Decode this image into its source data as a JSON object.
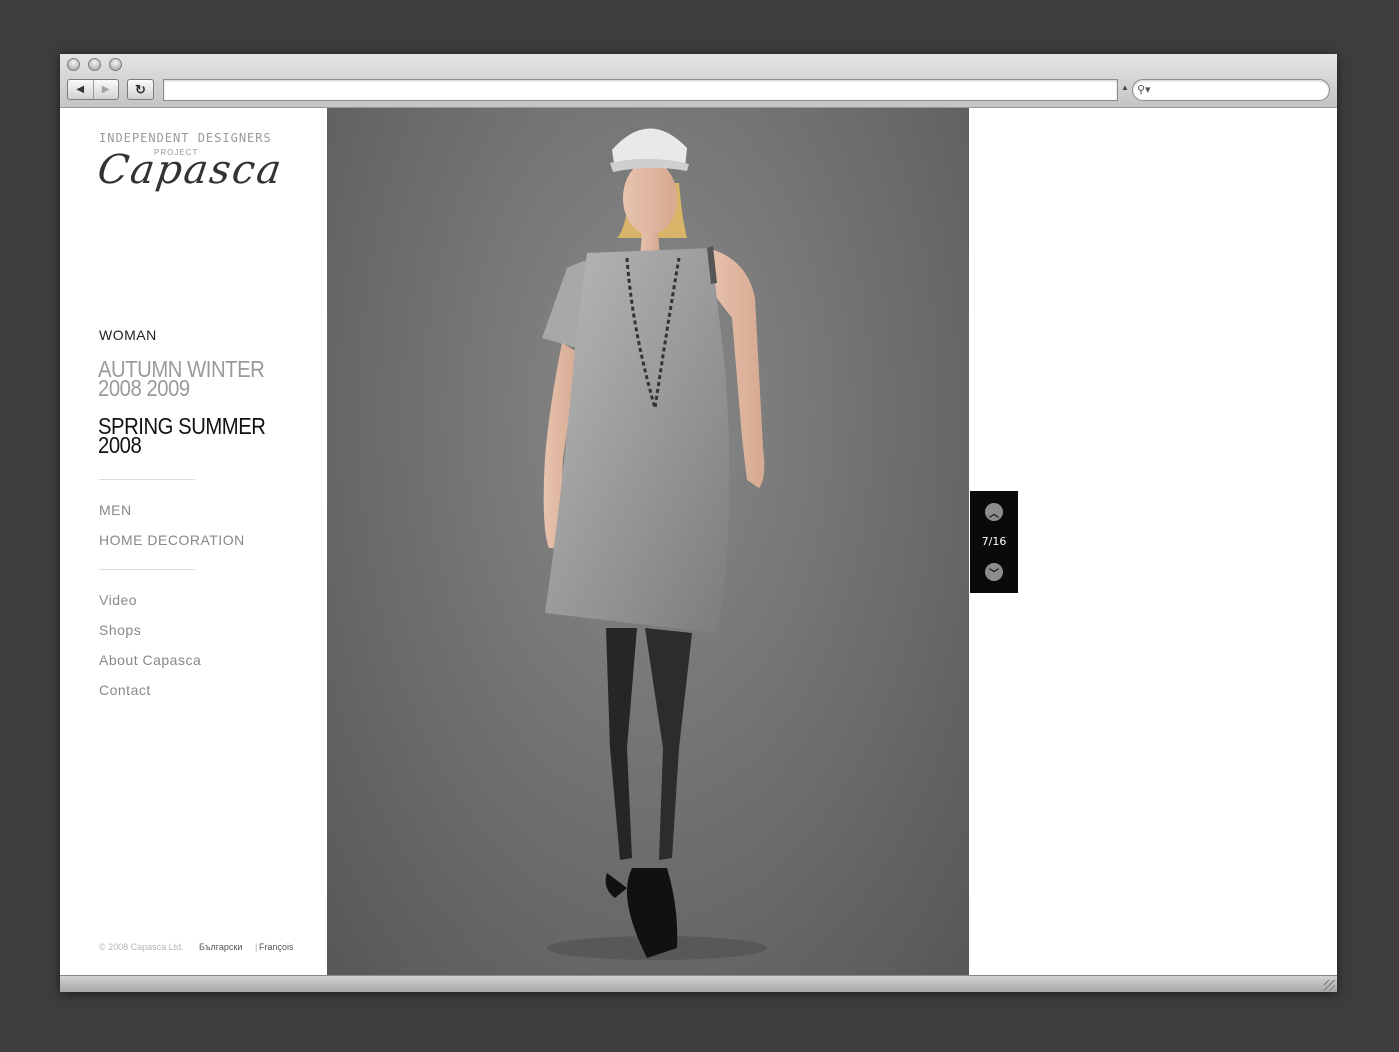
{
  "site": {
    "logo_top": "INDEPENDENT DESIGNERS",
    "logo_project": "PROJECT",
    "logo_name": "Capasca"
  },
  "nav": {
    "woman": "WOMAN",
    "season_aw_line1": "AUTUMN WINTER",
    "season_aw_line2": "2008 2009",
    "season_ss_line1": "SPRING SUMMER",
    "season_ss_line2": "2008",
    "men": "MEN",
    "home_decoration": "HOME DECORATION",
    "video": "Video",
    "shops": "Shops",
    "about": "About Capasca",
    "contact": "Contact"
  },
  "footer": {
    "copyright": "© 2008 Capasca Ltd.",
    "lang_bg": "Български",
    "separator": "|",
    "lang_fr": "François"
  },
  "gallery": {
    "counter": "7/16",
    "up_icon": "chevron-up-icon",
    "down_icon": "chevron-down-icon"
  },
  "browser": {
    "url_value": "",
    "search_value": ""
  }
}
